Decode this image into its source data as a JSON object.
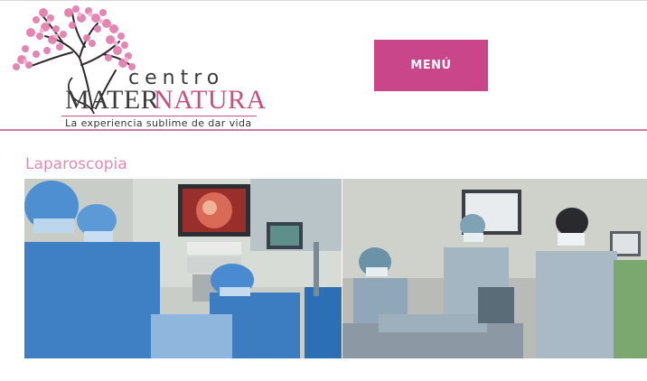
{
  "logo": {
    "centro": "centro",
    "mater": "MATER",
    "natura": "NATURA",
    "tagline": "La experiencia sublime de dar vida"
  },
  "header": {
    "menu_label": "MENÚ"
  },
  "page": {
    "title": "Laparoscopia"
  },
  "colors": {
    "brand_pink": "#c9468a",
    "title_pink": "#e08cb7",
    "header_rule": "#d477a3"
  },
  "icons": [
    "cherry-blossom-tree-logo-icon"
  ]
}
